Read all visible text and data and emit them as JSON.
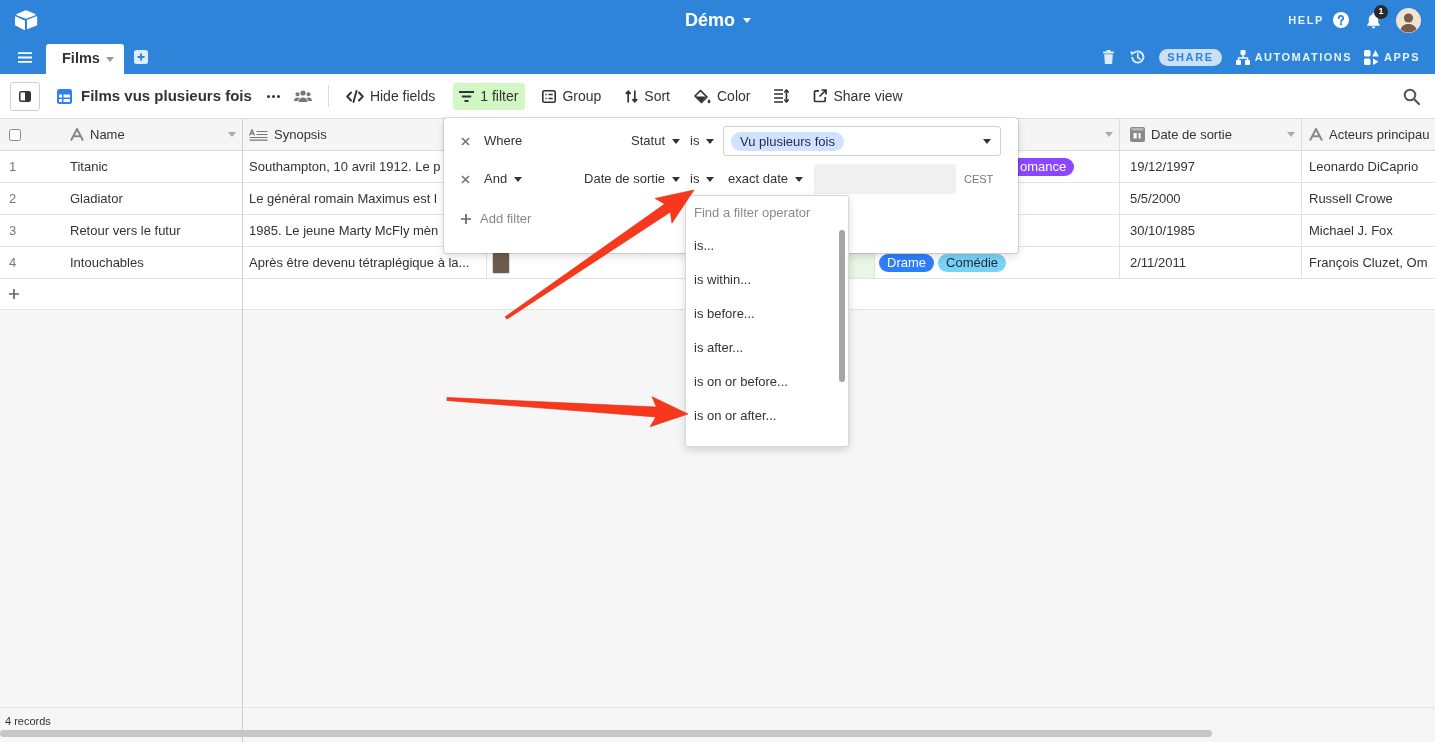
{
  "topbar": {
    "title": "Démo",
    "help": "HELP",
    "notification_count": "1"
  },
  "tabs": [
    {
      "label": "Films",
      "selected": true
    }
  ],
  "base_actions": [
    {
      "kind": "pill",
      "label": "SHARE"
    },
    {
      "kind": "link",
      "label": "AUTOMATIONS"
    },
    {
      "kind": "link",
      "label": "APPS"
    }
  ],
  "toolbar": {
    "view_name": "Films vus plusieurs fois",
    "buttons": [
      {
        "label": "Hide fields",
        "active": false
      },
      {
        "label": "1 filter",
        "active": true
      },
      {
        "label": "Group",
        "active": false
      },
      {
        "label": "Sort",
        "active": false
      },
      {
        "label": "Color",
        "active": false
      },
      {
        "active": false
      },
      {
        "label": "Share view",
        "active": false
      }
    ]
  },
  "table": {
    "select_all_checked": false,
    "columns": [
      {
        "kind": "text",
        "name": "Name",
        "menu": true
      },
      {
        "kind": "long_text",
        "name": "Synopsis"
      },
      {},
      {},
      {
        "menu": true
      },
      {
        "kind": "date",
        "name": "Date de sortie",
        "menu": true
      },
      {
        "kind": "text",
        "name": "Acteurs principau"
      }
    ],
    "rows": [
      {
        "number": "1",
        "cells": [
          {
            "text": "Titanic"
          },
          {
            "text": "Southampton, 10 avril 1912. Le p"
          },
          {},
          {},
          {
            "tags": [
              {
                "label": "omance",
                "color": "#8b46ff",
                "cut": true
              }
            ]
          },
          {
            "text": "19/12/1997"
          },
          {
            "text": "Leonardo DiCaprio"
          }
        ]
      },
      {
        "number": "2",
        "cells": [
          {
            "text": "Gladiator"
          },
          {
            "text": "Le général romain Maximus est l"
          },
          {},
          {},
          {},
          {
            "text": "5/5/2000"
          },
          {
            "text": "Russell Crowe"
          }
        ]
      },
      {
        "number": "3",
        "cells": [
          {
            "text": "Retour vers le futur"
          },
          {
            "text": "1985. Le jeune Marty McFly mèn"
          },
          {},
          {},
          {},
          {
            "text": "30/10/1985"
          },
          {
            "text": "Michael J. Fox"
          }
        ]
      },
      {
        "number": "4",
        "cells": [
          {
            "text": "Intouchables"
          },
          {
            "text": "Après être devenu tétraplégique à la..."
          },
          {
            "files": [
              {
                "kind": "photo"
              }
            ]
          },
          {
            "highlighted": true
          },
          {
            "tags": [
              {
                "label": "Drame",
                "color": "#2d7ff9"
              },
              {
                "label": "Comédie",
                "color": "#78d2f5"
              }
            ]
          },
          {
            "text": "2/11/2011"
          },
          {
            "text": "François Cluzet, Om"
          }
        ]
      }
    ]
  },
  "filter_panel": {
    "conditions": [
      {
        "conjunction": "Where",
        "conjunction_menu": false,
        "field": "Statut",
        "operator": "is",
        "value": {
          "kind": "select",
          "choices": [
            "Vu plusieurs fois"
          ]
        }
      },
      {
        "conjunction": "And",
        "conjunction_menu": true,
        "field": "Date de sortie",
        "operator": "is",
        "value": {
          "kind": "date",
          "mode": "exact date",
          "timezone": "CEST"
        },
        "operator_menu": {
          "placeholder": "Find a filter operator",
          "options": [
            {
              "label": "is...",
              "selected": false
            },
            {
              "label": "is within...",
              "selected": false
            },
            {
              "label": "is before...",
              "selected": false
            },
            {
              "label": "is after...",
              "selected": false
            },
            {
              "label": "is on or before...",
              "selected": false
            },
            {
              "label": "is on or after...",
              "selected": false
            }
          ]
        }
      }
    ],
    "add_label": "Add filter"
  },
  "status_bar": {
    "records": "4 records"
  },
  "annotations": [
    {
      "kind": "arrow"
    },
    {
      "kind": "arrow"
    }
  ]
}
